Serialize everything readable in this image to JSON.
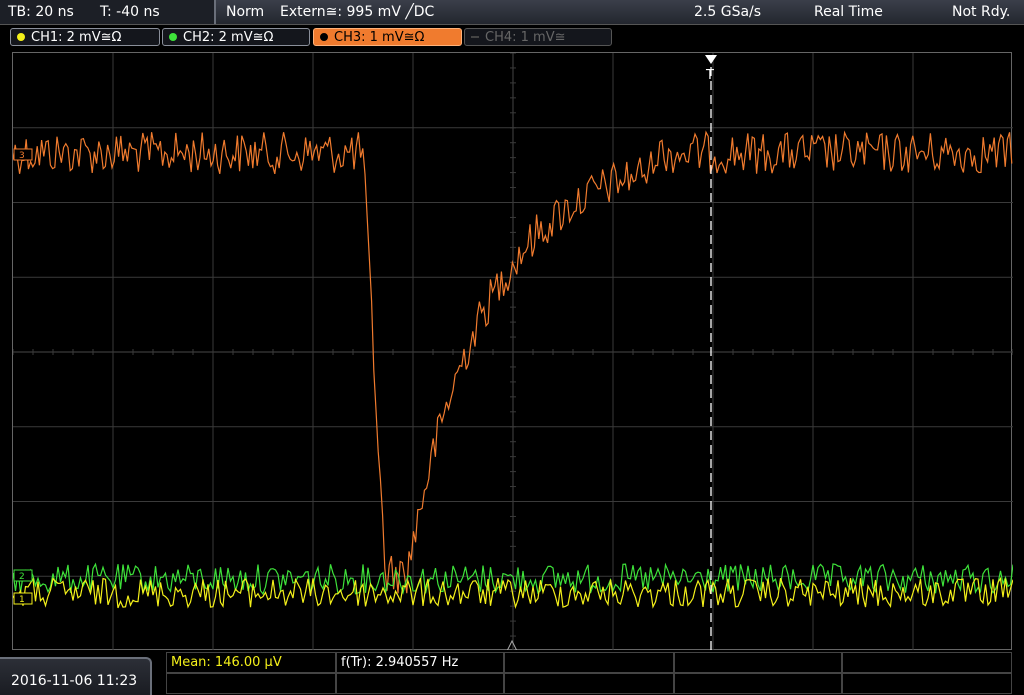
{
  "status": {
    "timebase": "TB: 20 ns",
    "trigger_time": "T: -40 ns",
    "mode": "Norm",
    "trigger_source": "Extern≅: 995 mV ╱DC",
    "sample_rate": "2.5 GSa/s",
    "acq_mode": "Real Time",
    "state": "Not Rdy."
  },
  "channels": [
    {
      "label": "CH1: 2 mV≅Ω",
      "color": "#f4f01a"
    },
    {
      "label": "CH2: 2 mV≅Ω",
      "color": "#3ee23a"
    },
    {
      "label": "CH3: 1 mV≅Ω",
      "color": "#f07b2e"
    },
    {
      "label": "CH4: 1 mV≅",
      "color": "#666666"
    }
  ],
  "markers": {
    "trigger_marker": "T",
    "ch1_marker": "1",
    "ch2_marker": "2",
    "ch3_marker": "3"
  },
  "measurements": {
    "mean": "Mean: 146.00 µV",
    "freq": "f(Tr): 2.940557 Hz"
  },
  "datetime": "2016-11-06 11:23",
  "colors": {
    "ch1": "#f4f01a",
    "ch2": "#3ee23a",
    "ch3": "#f07b2e",
    "grid": "#3a3a3a"
  }
}
